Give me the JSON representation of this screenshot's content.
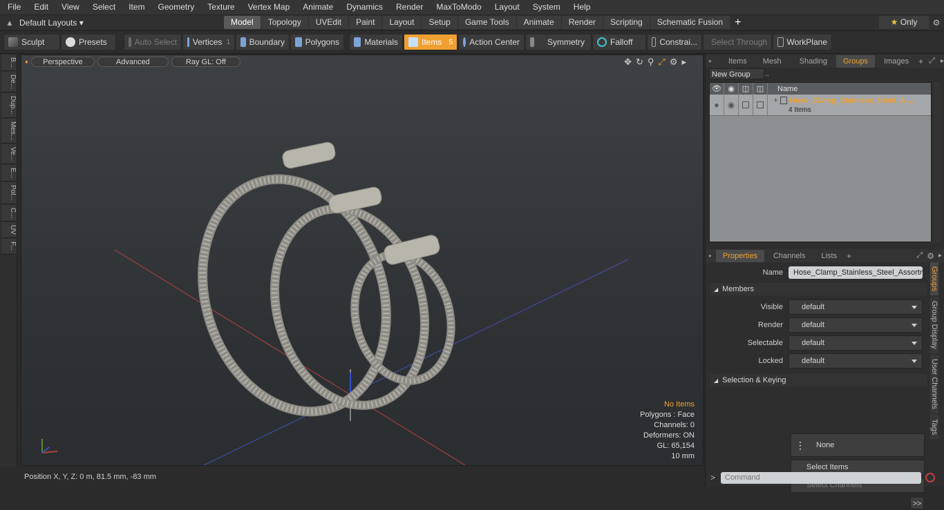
{
  "menu": [
    "File",
    "Edit",
    "View",
    "Select",
    "Item",
    "Geometry",
    "Texture",
    "Vertex Map",
    "Animate",
    "Dynamics",
    "Render",
    "MaxToModo",
    "Layout",
    "System",
    "Help"
  ],
  "layout": {
    "preset": "Default Layouts",
    "tabs": [
      "Model",
      "Topology",
      "UVEdit",
      "Paint",
      "Layout",
      "Setup",
      "Game Tools",
      "Animate",
      "Render",
      "Scripting",
      "Schematic Fusion"
    ],
    "active_tab": "Model",
    "only_label": "Only"
  },
  "toolbar": {
    "sculpt": "Sculpt",
    "presets": "Presets",
    "auto_select": "Auto Select",
    "vertices": "Vertices",
    "vertices_count": "1",
    "boundary": "Boundary",
    "polygons": "Polygons",
    "materials": "Materials",
    "items": "Items",
    "items_count": "5",
    "action_center": "Action Center",
    "symmetry": "Symmetry",
    "falloff": "Falloff",
    "constraints": "Constrai...",
    "select_through": "Select Through",
    "workplane": "WorkPlane"
  },
  "left_tabs": [
    "B...",
    "De...",
    "Dup...",
    "Mes...",
    "Ve...",
    "E...",
    "Pol...",
    "C...",
    "UV",
    "F..."
  ],
  "viewport": {
    "view": "Perspective",
    "shading": "Advanced",
    "raygl": "Ray GL: Off",
    "info": {
      "no_items": "No Items",
      "polygons": "Polygons : Face",
      "channels": "Channels: 0",
      "deformers": "Deformers: ON",
      "gl": "GL: 65,154",
      "scale": "10 mm"
    }
  },
  "status": {
    "position": "Position X, Y, Z:   0 m, 81.5 mm, -83 mm"
  },
  "top_panel": {
    "tabs": [
      "Items",
      "Mesh ...",
      "Shading",
      "Groups",
      "Images"
    ],
    "active": "Groups",
    "new_group": "New Group",
    "col_name": "Name",
    "group_name": "Hose_Clamp_Stainless_Steel_A ...",
    "group_count": "4 Items"
  },
  "properties": {
    "tabs": [
      "Properties",
      "Channels",
      "Lists"
    ],
    "active": "Properties",
    "name_label": "Name",
    "name_value": "Hose_Clamp_Stainless_Steel_Assortm",
    "members_section": "Members",
    "visible_label": "Visible",
    "visible_value": "default",
    "render_label": "Render",
    "render_value": "default",
    "selectable_label": "Selectable",
    "selectable_value": "default",
    "locked_label": "Locked",
    "locked_value": "default",
    "sel_section": "Selection & Keying",
    "none_label": "None",
    "select_items": "Select Items",
    "select_channels": "Select Channels",
    "more": ">>",
    "side_tabs": [
      "Groups",
      "Group Display",
      "User Channels",
      "Tags"
    ]
  },
  "command": {
    "placeholder": "Command"
  },
  "colors": {
    "accent": "#f0a030",
    "selected_row": "#a4a7aa",
    "list_bg": "#8d9092"
  }
}
